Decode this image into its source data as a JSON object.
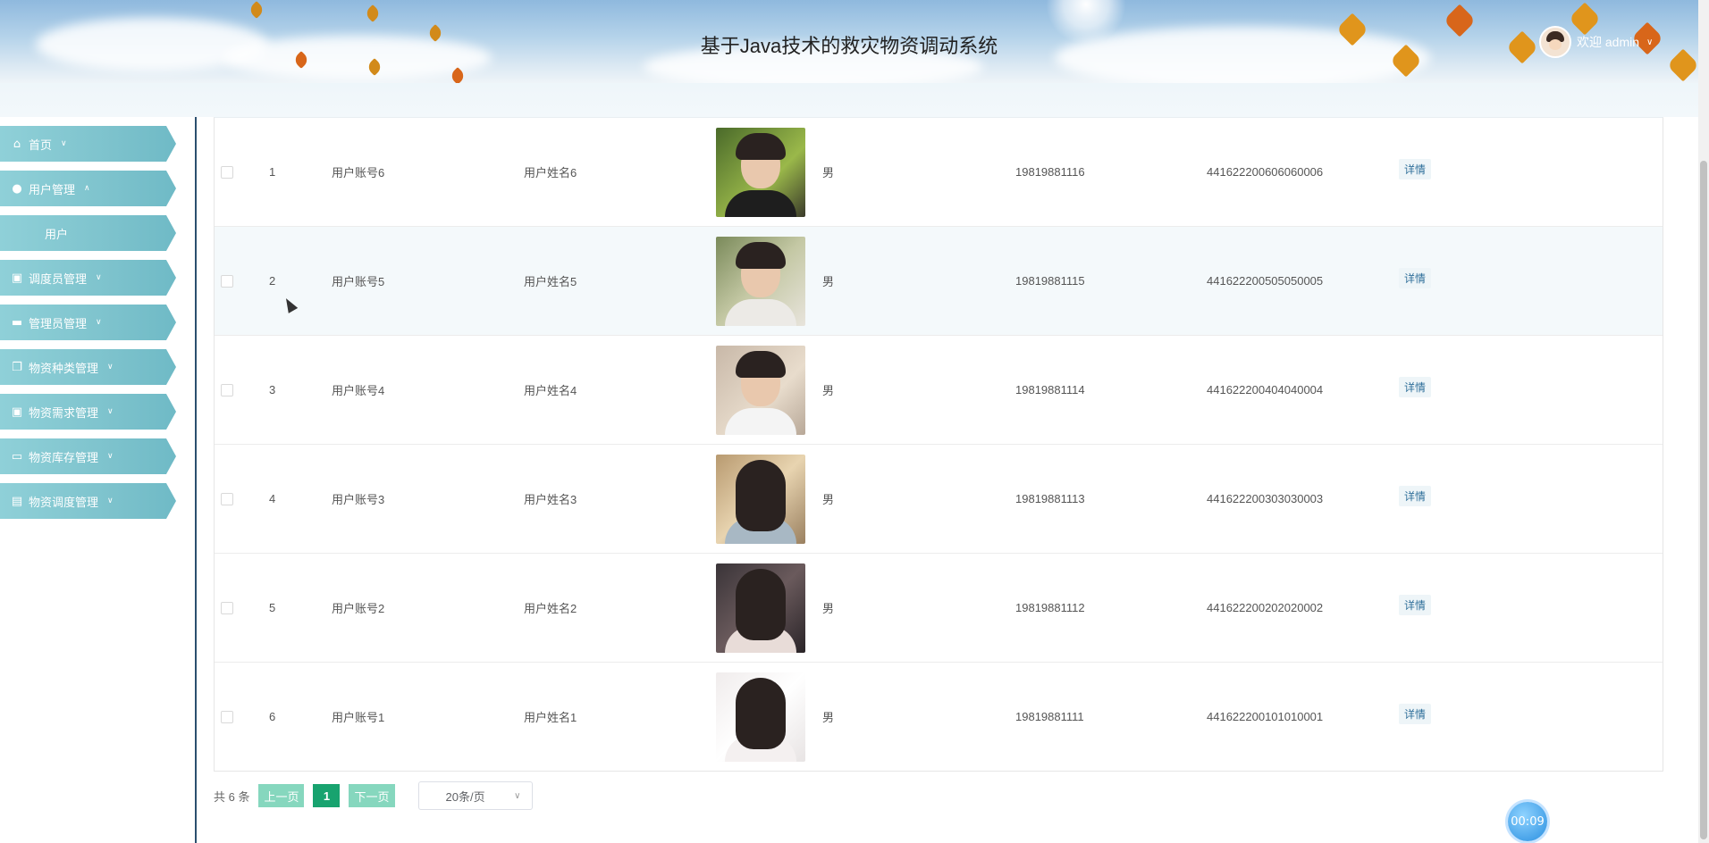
{
  "header": {
    "title": "基于Java技术的救灾物资调动系统",
    "welcome": "欢迎 admin"
  },
  "sidebar": {
    "items": [
      {
        "icon": "home-icon",
        "label": "首页",
        "caret": "∨"
      },
      {
        "icon": "user-icon",
        "label": "用户管理",
        "caret": "∧"
      },
      {
        "icon": "",
        "label": "用户",
        "caret": ""
      },
      {
        "icon": "briefcase-icon",
        "label": "调度员管理",
        "caret": "∨"
      },
      {
        "icon": "card-icon",
        "label": "管理员管理",
        "caret": "∨"
      },
      {
        "icon": "copy-icon",
        "label": "物资种类管理",
        "caret": "∨"
      },
      {
        "icon": "briefcase-icon",
        "label": "物资需求管理",
        "caret": "∨"
      },
      {
        "icon": "folder-icon",
        "label": "物资库存管理",
        "caret": "∨"
      },
      {
        "icon": "badge-icon",
        "label": "物资调度管理",
        "caret": "∨"
      }
    ]
  },
  "table": {
    "action_label": "详情",
    "rows": [
      {
        "index": "1",
        "account": "用户账号6",
        "name": "用户姓名6",
        "sex": "男",
        "phone": "19819881116",
        "id_card": "441622200606060006",
        "photo": "male-photo-1"
      },
      {
        "index": "2",
        "account": "用户账号5",
        "name": "用户姓名5",
        "sex": "男",
        "phone": "19819881115",
        "id_card": "441622200505050005",
        "photo": "male-photo-2"
      },
      {
        "index": "3",
        "account": "用户账号4",
        "name": "用户姓名4",
        "sex": "男",
        "phone": "19819881114",
        "id_card": "441622200404040004",
        "photo": "male-photo-3"
      },
      {
        "index": "4",
        "account": "用户账号3",
        "name": "用户姓名3",
        "sex": "男",
        "phone": "19819881113",
        "id_card": "441622200303030003",
        "photo": "female-photo-1"
      },
      {
        "index": "5",
        "account": "用户账号2",
        "name": "用户姓名2",
        "sex": "男",
        "phone": "19819881112",
        "id_card": "441622200202020002",
        "photo": "female-photo-2"
      },
      {
        "index": "6",
        "account": "用户账号1",
        "name": "用户姓名1",
        "sex": "男",
        "phone": "19819881111",
        "id_card": "441622200101010001",
        "photo": "female-photo-3"
      }
    ]
  },
  "pagination": {
    "total": "共 6 条",
    "prev": "上一页",
    "current": "1",
    "next": "下一页",
    "page_size": "20条/页"
  },
  "timer": "00:09",
  "colors": {
    "menu_bg": "#7ec3cd",
    "active_page": "#18a36f",
    "pager_btn": "#86d7be",
    "detail_text": "#2f6f9a"
  }
}
